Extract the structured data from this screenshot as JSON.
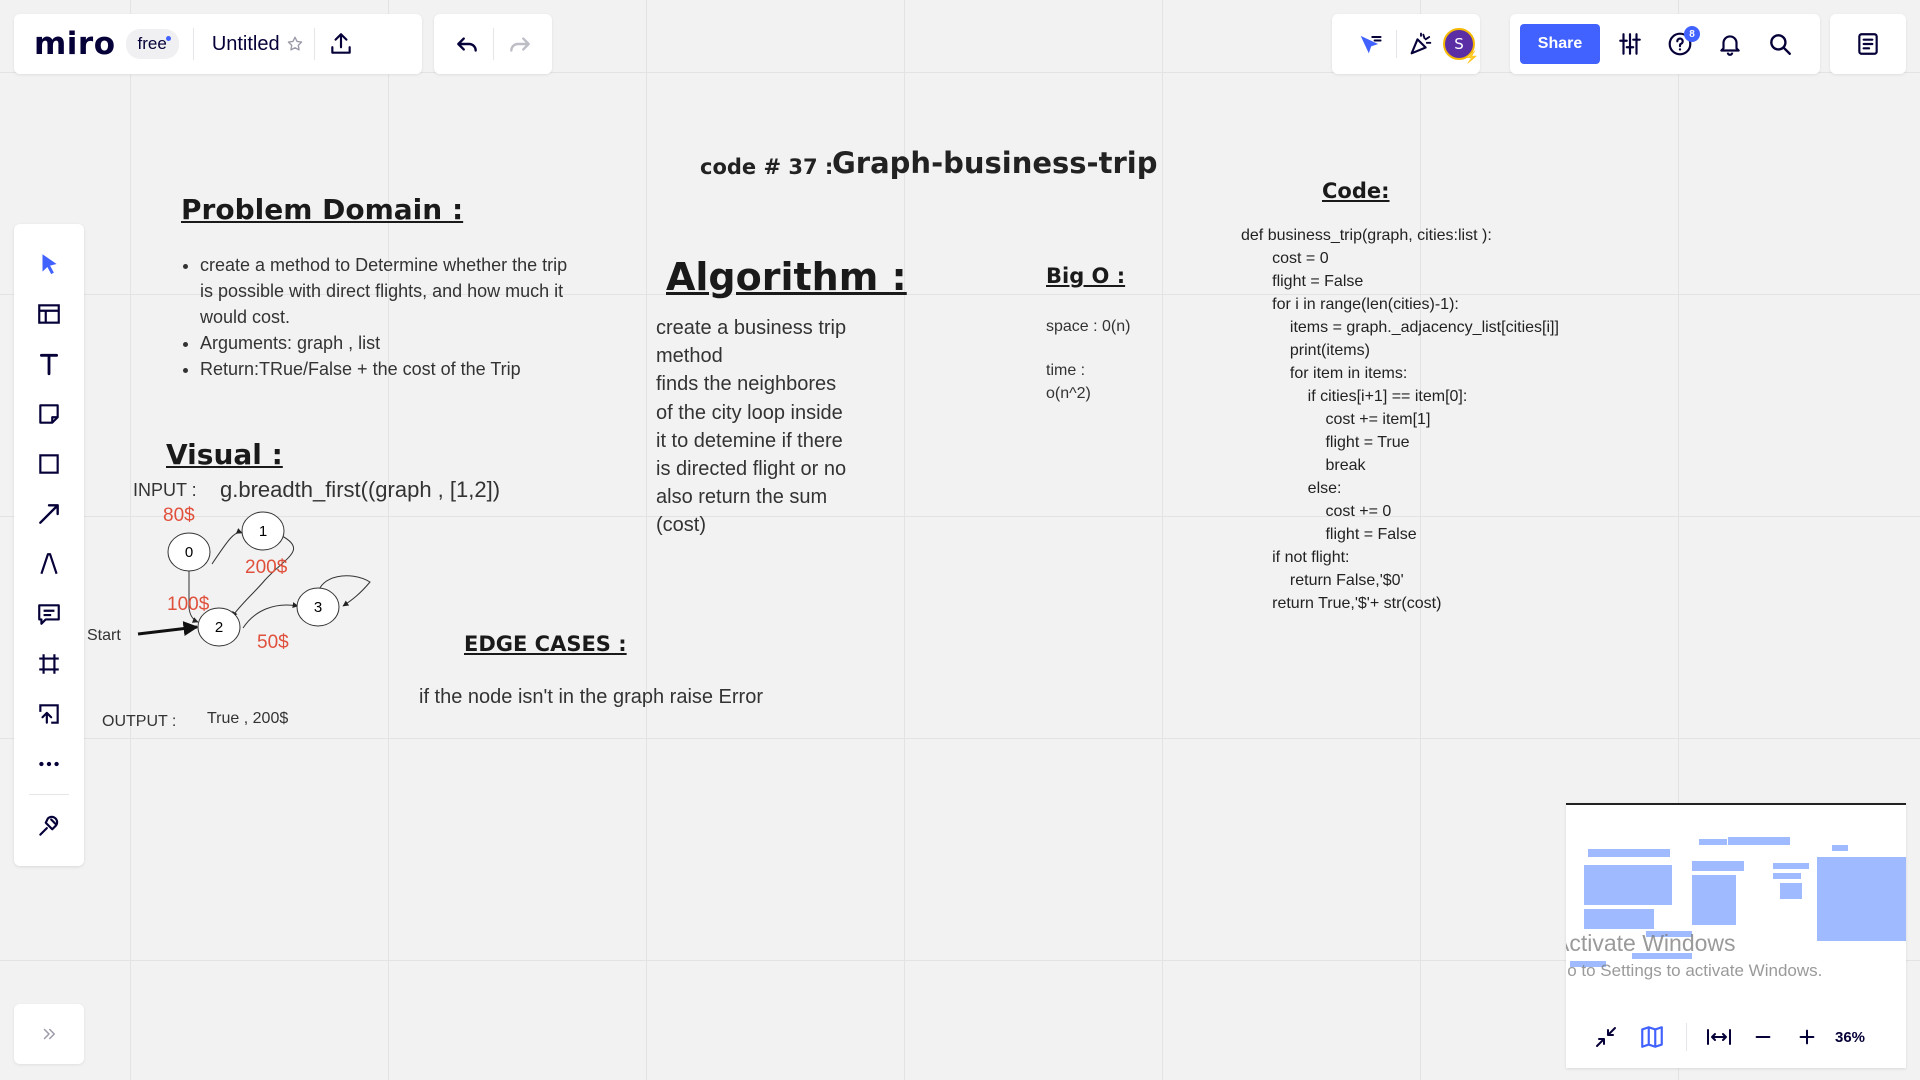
{
  "app": {
    "logo": "miro",
    "plan_badge": "free",
    "board_title": "Untitled"
  },
  "toolbar_right": {
    "avatar_initial": "S",
    "share_label": "Share",
    "help_badge_count": "8"
  },
  "left_toolbar": {
    "tools": [
      "select-tool",
      "templates-tool",
      "text-tool",
      "sticky-note-tool",
      "shape-tool",
      "connection-line-tool",
      "pen-tool",
      "comment-tool",
      "frame-tool",
      "upload-tool",
      "more-tools",
      "apps-tool"
    ]
  },
  "board": {
    "title_prefix": "code # 37 :",
    "title": "Graph-business-trip",
    "problem_domain": {
      "heading": "Problem Domain :",
      "items": [
        "create a method to Determine whether the trip is possible with direct flights, and how much it would cost.",
        "Arguments: graph , list",
        "Return:TRue/False + the cost of the Trip"
      ]
    },
    "algorithm": {
      "heading": "Algorithm :",
      "body": "create a business trip\nmethod\nfinds the neighbores\nof the city loop inside\nit to detemine if there\nis directed flight or no\nalso return the sum\n(cost)"
    },
    "big_o": {
      "heading": "Big O :",
      "space": "space : 0(n)",
      "time_label": "time :",
      "time_value": "o(n^2)"
    },
    "code": {
      "heading": "Code:",
      "lines": "def business_trip(graph, cities:list ):\n       cost = 0\n       flight = False\n       for i in range(len(cities)-1):\n           items = graph._adjacency_list[cities[i]]\n           print(items)\n           for item in items:\n               if cities[i+1] == item[0]:\n                   cost += item[1]\n                   flight = True\n                   break\n               else:\n                   cost += 0\n                   flight = False\n       if not flight:\n           return False,'$0'\n       return True,'$'+ str(cost)"
    },
    "visual": {
      "heading": "Visual :",
      "input_label": "INPUT :",
      "input_value": "g.breadth_first((graph , [1,2])",
      "nodes": [
        "0",
        "1",
        "2",
        "3"
      ],
      "edge_weights": [
        "80$",
        "200$",
        "100$",
        "50$"
      ],
      "start_label": "Start",
      "output_label": "OUTPUT :",
      "output_value": "True , 200$"
    },
    "edge_cases": {
      "heading": "EDGE CASES :",
      "body": "if the node isn't in the graph raise Error"
    }
  },
  "watermark": {
    "line1": "Activate Windows",
    "line2": "Go to Settings to activate Windows."
  },
  "zoom": {
    "level": "36%"
  }
}
